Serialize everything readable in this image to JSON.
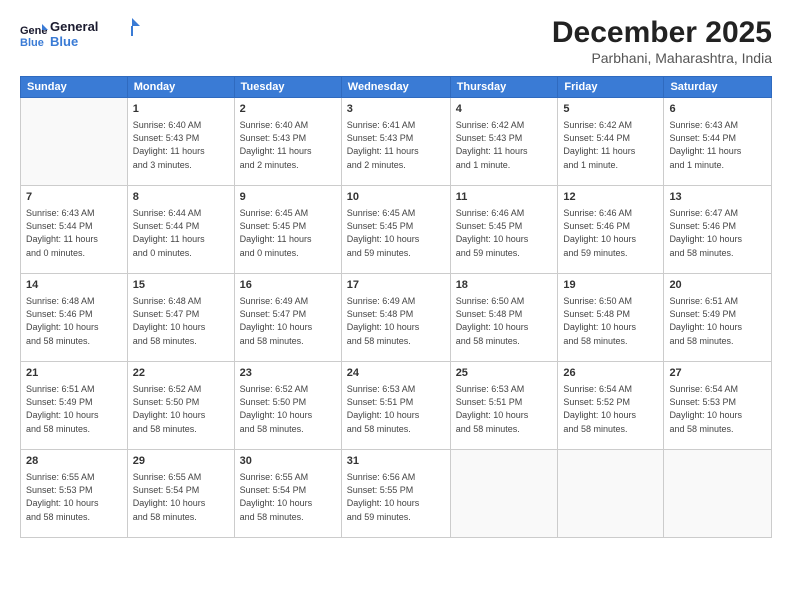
{
  "header": {
    "logo_line1": "General",
    "logo_line2": "Blue",
    "month_year": "December 2025",
    "location": "Parbhani, Maharashtra, India"
  },
  "days_of_week": [
    "Sunday",
    "Monday",
    "Tuesday",
    "Wednesday",
    "Thursday",
    "Friday",
    "Saturday"
  ],
  "weeks": [
    [
      {
        "day": "",
        "info": ""
      },
      {
        "day": "1",
        "info": "Sunrise: 6:40 AM\nSunset: 5:43 PM\nDaylight: 11 hours\nand 3 minutes."
      },
      {
        "day": "2",
        "info": "Sunrise: 6:40 AM\nSunset: 5:43 PM\nDaylight: 11 hours\nand 2 minutes."
      },
      {
        "day": "3",
        "info": "Sunrise: 6:41 AM\nSunset: 5:43 PM\nDaylight: 11 hours\nand 2 minutes."
      },
      {
        "day": "4",
        "info": "Sunrise: 6:42 AM\nSunset: 5:43 PM\nDaylight: 11 hours\nand 1 minute."
      },
      {
        "day": "5",
        "info": "Sunrise: 6:42 AM\nSunset: 5:44 PM\nDaylight: 11 hours\nand 1 minute."
      },
      {
        "day": "6",
        "info": "Sunrise: 6:43 AM\nSunset: 5:44 PM\nDaylight: 11 hours\nand 1 minute."
      }
    ],
    [
      {
        "day": "7",
        "info": "Sunrise: 6:43 AM\nSunset: 5:44 PM\nDaylight: 11 hours\nand 0 minutes."
      },
      {
        "day": "8",
        "info": "Sunrise: 6:44 AM\nSunset: 5:44 PM\nDaylight: 11 hours\nand 0 minutes."
      },
      {
        "day": "9",
        "info": "Sunrise: 6:45 AM\nSunset: 5:45 PM\nDaylight: 11 hours\nand 0 minutes."
      },
      {
        "day": "10",
        "info": "Sunrise: 6:45 AM\nSunset: 5:45 PM\nDaylight: 10 hours\nand 59 minutes."
      },
      {
        "day": "11",
        "info": "Sunrise: 6:46 AM\nSunset: 5:45 PM\nDaylight: 10 hours\nand 59 minutes."
      },
      {
        "day": "12",
        "info": "Sunrise: 6:46 AM\nSunset: 5:46 PM\nDaylight: 10 hours\nand 59 minutes."
      },
      {
        "day": "13",
        "info": "Sunrise: 6:47 AM\nSunset: 5:46 PM\nDaylight: 10 hours\nand 58 minutes."
      }
    ],
    [
      {
        "day": "14",
        "info": "Sunrise: 6:48 AM\nSunset: 5:46 PM\nDaylight: 10 hours\nand 58 minutes."
      },
      {
        "day": "15",
        "info": "Sunrise: 6:48 AM\nSunset: 5:47 PM\nDaylight: 10 hours\nand 58 minutes."
      },
      {
        "day": "16",
        "info": "Sunrise: 6:49 AM\nSunset: 5:47 PM\nDaylight: 10 hours\nand 58 minutes."
      },
      {
        "day": "17",
        "info": "Sunrise: 6:49 AM\nSunset: 5:48 PM\nDaylight: 10 hours\nand 58 minutes."
      },
      {
        "day": "18",
        "info": "Sunrise: 6:50 AM\nSunset: 5:48 PM\nDaylight: 10 hours\nand 58 minutes."
      },
      {
        "day": "19",
        "info": "Sunrise: 6:50 AM\nSunset: 5:48 PM\nDaylight: 10 hours\nand 58 minutes."
      },
      {
        "day": "20",
        "info": "Sunrise: 6:51 AM\nSunset: 5:49 PM\nDaylight: 10 hours\nand 58 minutes."
      }
    ],
    [
      {
        "day": "21",
        "info": "Sunrise: 6:51 AM\nSunset: 5:49 PM\nDaylight: 10 hours\nand 58 minutes."
      },
      {
        "day": "22",
        "info": "Sunrise: 6:52 AM\nSunset: 5:50 PM\nDaylight: 10 hours\nand 58 minutes."
      },
      {
        "day": "23",
        "info": "Sunrise: 6:52 AM\nSunset: 5:50 PM\nDaylight: 10 hours\nand 58 minutes."
      },
      {
        "day": "24",
        "info": "Sunrise: 6:53 AM\nSunset: 5:51 PM\nDaylight: 10 hours\nand 58 minutes."
      },
      {
        "day": "25",
        "info": "Sunrise: 6:53 AM\nSunset: 5:51 PM\nDaylight: 10 hours\nand 58 minutes."
      },
      {
        "day": "26",
        "info": "Sunrise: 6:54 AM\nSunset: 5:52 PM\nDaylight: 10 hours\nand 58 minutes."
      },
      {
        "day": "27",
        "info": "Sunrise: 6:54 AM\nSunset: 5:53 PM\nDaylight: 10 hours\nand 58 minutes."
      }
    ],
    [
      {
        "day": "28",
        "info": "Sunrise: 6:55 AM\nSunset: 5:53 PM\nDaylight: 10 hours\nand 58 minutes."
      },
      {
        "day": "29",
        "info": "Sunrise: 6:55 AM\nSunset: 5:54 PM\nDaylight: 10 hours\nand 58 minutes."
      },
      {
        "day": "30",
        "info": "Sunrise: 6:55 AM\nSunset: 5:54 PM\nDaylight: 10 hours\nand 58 minutes."
      },
      {
        "day": "31",
        "info": "Sunrise: 6:56 AM\nSunset: 5:55 PM\nDaylight: 10 hours\nand 59 minutes."
      },
      {
        "day": "",
        "info": ""
      },
      {
        "day": "",
        "info": ""
      },
      {
        "day": "",
        "info": ""
      }
    ]
  ]
}
